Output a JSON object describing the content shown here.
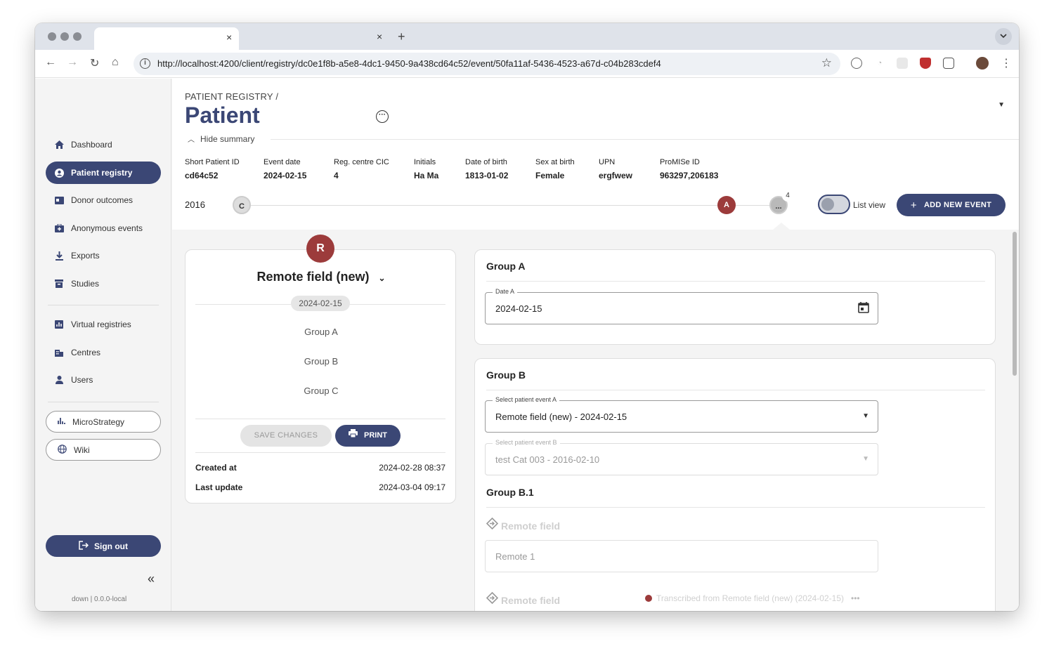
{
  "browser": {
    "tab_close": "×",
    "tab_new": "+",
    "url": "http://localhost:4200/client/registry/dc0e1f8b-a5e8-4dc1-9450-9a438cd64c52/event/50fa11af-5436-4523-a67d-c04b283cdef4"
  },
  "sidebar": {
    "items": [
      {
        "label": "Dashboard",
        "icon": "home-icon"
      },
      {
        "label": "Patient registry",
        "icon": "person-icon",
        "active": true
      },
      {
        "label": "Donor outcomes",
        "icon": "badge-icon"
      },
      {
        "label": "Anonymous events",
        "icon": "medical-bag-icon"
      },
      {
        "label": "Exports",
        "icon": "download-icon"
      },
      {
        "label": "Studies",
        "icon": "archive-icon"
      },
      {
        "label": "Virtual registries",
        "icon": "chart-box-icon"
      },
      {
        "label": "Centres",
        "icon": "building-icon"
      },
      {
        "label": "Users",
        "icon": "user-icon"
      }
    ],
    "links": [
      {
        "label": "MicroStrategy",
        "icon": "bar-chart-icon"
      },
      {
        "label": "Wiki",
        "icon": "globe-icon"
      }
    ],
    "sign_out": "Sign out",
    "version": "down | 0.0.0-local"
  },
  "header": {
    "breadcrumb": "PATIENT REGISTRY  /",
    "title": "Patient",
    "hide_summary": "Hide summary",
    "summary": [
      {
        "label": "Short Patient ID",
        "value": "cd64c52"
      },
      {
        "label": "Event date",
        "value": "2024-02-15"
      },
      {
        "label": "Reg. centre CIC",
        "value": "4"
      },
      {
        "label": "Initials",
        "value": "Ha Ma"
      },
      {
        "label": "Date of birth",
        "value": "1813-01-02"
      },
      {
        "label": "Sex at birth",
        "value": "Female"
      },
      {
        "label": "UPN",
        "value": "ergfwew"
      },
      {
        "label": "ProMISe ID",
        "value": "963297,206183"
      }
    ]
  },
  "timeline": {
    "year": "2016",
    "dot_c": "C",
    "dot_a": "A",
    "dot_more": "...",
    "more_count": "4",
    "list_view": "List view",
    "add_event": "ADD NEW EVENT"
  },
  "event_card": {
    "avatar": "R",
    "title": "Remote field (new)",
    "date": "2024-02-15",
    "groups": [
      "Group A",
      "Group B",
      "Group C"
    ],
    "save": "SAVE CHANGES",
    "print": "PRINT",
    "created_label": "Created at",
    "created_value": "2024-02-28 08:37",
    "updated_label": "Last update",
    "updated_value": "2024-03-04 09:17"
  },
  "group_a": {
    "title": "Group A",
    "date_label": "Date A",
    "date_value": "2024-02-15"
  },
  "group_b": {
    "title": "Group B",
    "event_a_label": "Select patient event A",
    "event_a_value": "Remote field (new) - 2024-02-15",
    "event_b_label": "Select patient event B",
    "event_b_value": "test Cat 003 - 2016-02-10",
    "sub_title": "Group B.1",
    "remote_label_1": "Remote field",
    "remote_value_1": "Remote 1",
    "remote_label_2": "Remote field",
    "transcribed": "Transcribed from Remote field (new) (2024-02-15)"
  },
  "colors": {
    "primary": "#3b4775",
    "accent_red": "#9c3b3b",
    "background": "#f4f4f4"
  }
}
